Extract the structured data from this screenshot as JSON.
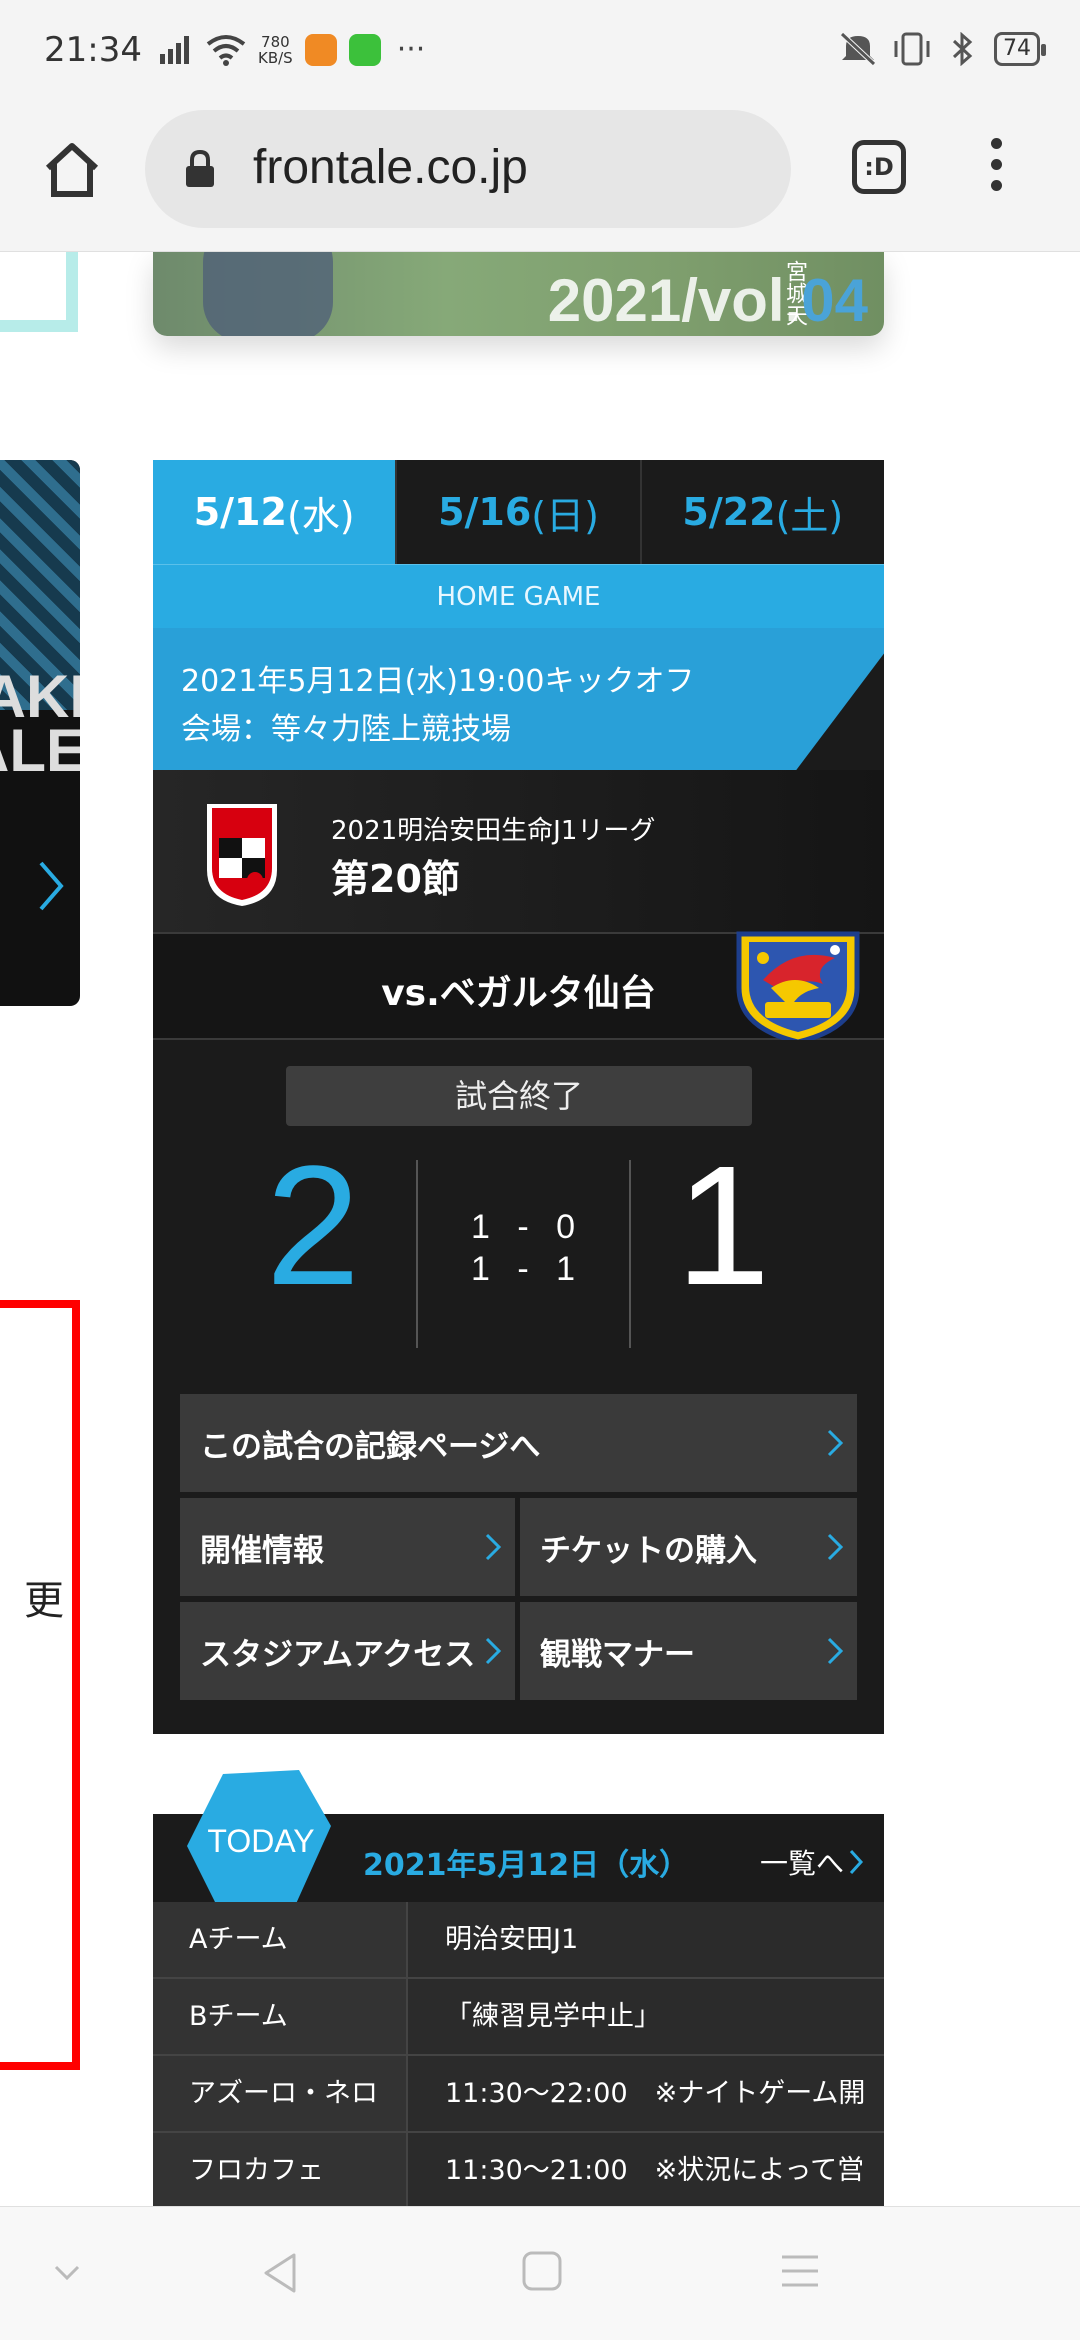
{
  "status_bar": {
    "time": "21:34",
    "net_speed_value": "780",
    "net_speed_unit": "KB/S",
    "overflow": "···",
    "battery": "74"
  },
  "browser": {
    "url": "frontale.co.jp",
    "tab_label": ":D"
  },
  "banner": {
    "text_main": "2021/vol.",
    "text_highlight": "04",
    "vertical_text": "宮城天"
  },
  "side_card": {
    "text": "AKI\nALE"
  },
  "side_box": {
    "cut_text": "更"
  },
  "match": {
    "date_tabs": [
      {
        "date": "5/12",
        "dow": "(水)"
      },
      {
        "date": "5/16",
        "dow": "(日)"
      },
      {
        "date": "5/22",
        "dow": "(土)"
      }
    ],
    "home_game_label": "HOME GAME",
    "kickoff": "2021年5月12日(水)19:00キックオフ",
    "venue": "会場：等々力陸上競技場",
    "league": "2021明治安田生命J1リーグ",
    "round": "第20節",
    "opponent": "vs.ベガルタ仙台",
    "status": "試合終了",
    "score_home": "2",
    "score_away": "1",
    "half1": "1 - 0",
    "half2": "1 - 1",
    "buttons": {
      "record": "この試合の記録ページへ",
      "info": "開催情報",
      "ticket": "チケットの購入",
      "access": "スタジアムアクセス",
      "manner": "観戦マナー"
    },
    "colors": {
      "accent": "#29abe2",
      "panel": "#1b1b1b"
    }
  },
  "today": {
    "badge": "TODAY",
    "date": "2021年5月12日（水）",
    "more": "一覧へ",
    "rows": [
      {
        "team": "Aチーム",
        "info": "明治安田J1"
      },
      {
        "team": "Bチーム",
        "info": "「練習見学中止」"
      },
      {
        "team": "アズーロ・ネロ",
        "info": "11:30〜22:00　※ナイトゲーム開"
      },
      {
        "team": "フロカフェ",
        "info": "11:30〜21:00　※状況によって営"
      }
    ]
  }
}
